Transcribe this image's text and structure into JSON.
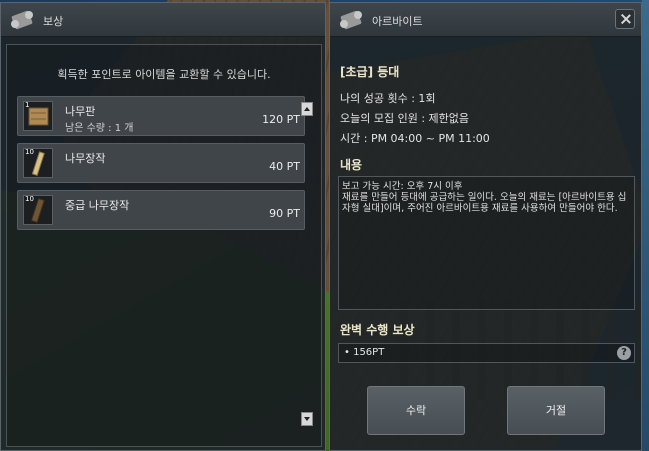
{
  "reward_panel": {
    "title": "보상",
    "description": "획득한 포인트로 아이템을 교환할 수 있습니다.",
    "items": [
      {
        "name": "나무판",
        "sub": "남은 수량 : 1 개",
        "price": "120 PT",
        "stack": "1",
        "icon": "wood-plank-icon"
      },
      {
        "name": "나무장작",
        "sub": "",
        "price": "40 PT",
        "stack": "10",
        "icon": "firewood-icon"
      },
      {
        "name": "중급 나무장작",
        "sub": "",
        "price": "90 PT",
        "stack": "10",
        "icon": "dark-firewood-icon"
      }
    ]
  },
  "job_panel": {
    "title": "아르바이트",
    "job_title": "[초급] 등대",
    "success_count": "나의 성공 횟수 : 1회",
    "recruit": "오늘의 모집 인원 : 제한없음",
    "time": "시간 : PM 04:00 ~ PM 11:00",
    "content_heading": "내용",
    "content_text": "보고 가능 시간: 오후 7시 이후\n재료를 만들어 등대에 공급하는 일이다. 오늘의 재료는 [아르바이트용 십자형 실대]이며, 주어진 아르바이트용 재료를 사용하여 만들어야 한다.",
    "reward_heading": "완벽 수행 보상",
    "reward_value": "• 156PT",
    "help": "?",
    "accept_label": "수락",
    "reject_label": "거절"
  }
}
